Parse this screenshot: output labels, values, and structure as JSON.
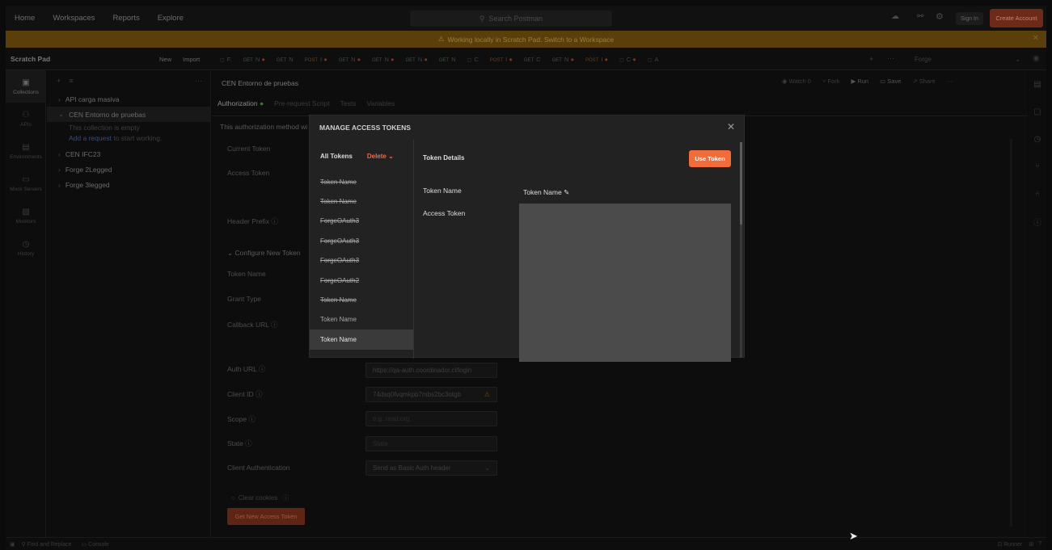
{
  "topbar": {
    "nav": [
      "Home",
      "Workspaces",
      "Reports",
      "Explore"
    ],
    "search_placeholder": "Search Postman",
    "signin": "Sign In",
    "create_account": "Create Account"
  },
  "banner": {
    "text": "Working locally in Scratch Pad. Switch to a Workspace"
  },
  "workspace": {
    "title": "Scratch Pad",
    "new": "New",
    "import": "Import",
    "tabs": [
      {
        "method": "",
        "label": "F.",
        "cls": ""
      },
      {
        "method": "GET",
        "label": "N",
        "cls": "g",
        "dot": true
      },
      {
        "method": "GET",
        "label": "N",
        "cls": "g"
      },
      {
        "method": "POST",
        "label": "I",
        "cls": "o",
        "dot": true
      },
      {
        "method": "GET",
        "label": "N",
        "cls": "g",
        "dot": true
      },
      {
        "method": "GET",
        "label": "N",
        "cls": "g",
        "dot": true
      },
      {
        "method": "GET",
        "label": "N",
        "cls": "g",
        "dot": true
      },
      {
        "method": "GET",
        "label": "N",
        "cls": "g"
      },
      {
        "method": "",
        "label": "C",
        "cls": ""
      },
      {
        "method": "POST",
        "label": "I",
        "cls": "o",
        "dot": true
      },
      {
        "method": "GET",
        "label": "C",
        "cls": "g"
      },
      {
        "method": "GET",
        "label": "N",
        "cls": "g",
        "dot": true
      },
      {
        "method": "POST",
        "label": "I",
        "cls": "o",
        "dot": true
      },
      {
        "method": "",
        "label": "C",
        "cls": "",
        "dot": true
      },
      {
        "method": "",
        "label": "A",
        "cls": ""
      }
    ],
    "env": "Forge"
  },
  "leftnav": [
    "Collections",
    "APIs",
    "Environments",
    "Mock Servers",
    "Monitors",
    "History"
  ],
  "sidebar": {
    "items": [
      {
        "label": "API carga masiva"
      },
      {
        "label": "CEN Entorno de pruebas",
        "selected": true
      },
      {
        "label": "CEN IFC23"
      },
      {
        "label": "Forge 2Legged"
      },
      {
        "label": "Forge 3legged"
      }
    ],
    "empty_line1": "This collection is empty",
    "empty_link": "Add a request",
    "empty_line2": "to start working."
  },
  "main": {
    "title": "CEN Entorno de pruebas",
    "actions": {
      "watch": "Watch",
      "watch_count": "0",
      "fork": "Fork",
      "run": "Run",
      "save": "Save",
      "share": "Share"
    },
    "tabs": [
      "Authorization",
      "Pre-request Script",
      "Tests",
      "Variables"
    ],
    "auth_note": "This authorization method wi",
    "labels": {
      "current_token": "Current Token",
      "access_token": "Access Token",
      "header_prefix": "Header Prefix",
      "configure": "Configure New Token",
      "token_name": "Token Name",
      "grant_type": "Grant Type",
      "callback_url": "Callback URL",
      "auth_url": "Auth URL",
      "client_id": "Client ID",
      "scope": "Scope",
      "state": "State",
      "client_auth": "Client Authentication"
    },
    "values": {
      "auth_url": "https://qa-auth.coordinador.cl/login",
      "client_id": "74dsq0fvqmkpb7mbs2bc3otgb",
      "scope": "e.g. read:org",
      "state": "State",
      "client_auth": "Send as Basic Auth header"
    },
    "clear_cookies": "Clear cookies",
    "get_token": "Get New Access Token"
  },
  "modal": {
    "title": "MANAGE ACCESS TOKENS",
    "list_all": "All Tokens",
    "list_delete": "Delete",
    "tokens": [
      {
        "name": "Token Name",
        "struck": true
      },
      {
        "name": "Token Name",
        "struck": true
      },
      {
        "name": "ForgeOAuth3",
        "struck": true
      },
      {
        "name": "ForgeOAuth3",
        "struck": true
      },
      {
        "name": "ForgeOAuth3",
        "struck": true
      },
      {
        "name": "ForgeOAuth2",
        "struck": true
      },
      {
        "name": "Token Name",
        "struck": true
      },
      {
        "name": "Token Name",
        "struck": false
      },
      {
        "name": "Token Name",
        "struck": false,
        "selected": true
      }
    ],
    "details_title": "Token Details",
    "use_token": "Use Token",
    "token_name_label": "Token Name",
    "token_name_value": "Token Name",
    "access_token_label": "Access Token"
  },
  "status": {
    "find": "Find and Replace",
    "console": "Console",
    "runner": "Runner"
  }
}
